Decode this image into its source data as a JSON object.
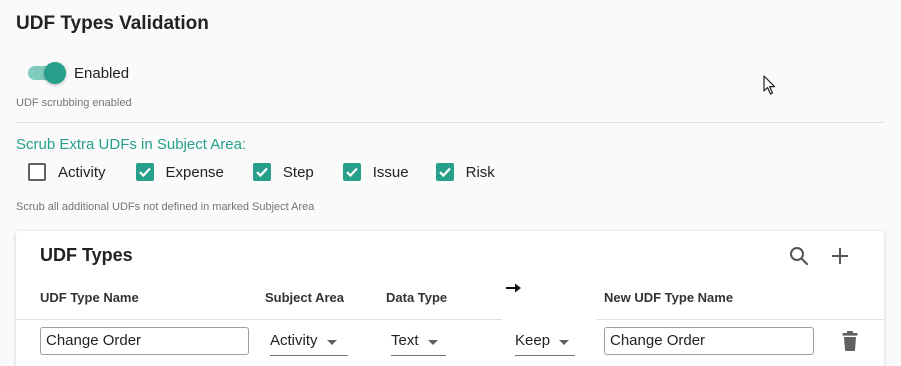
{
  "page": {
    "title": "UDF Types Validation"
  },
  "toggle": {
    "label": "Enabled",
    "state": "on",
    "hint": "UDF scrubbing enabled"
  },
  "scrub": {
    "heading": "Scrub Extra UDFs in Subject Area:",
    "hint": "Scrub all additional UDFs not defined in marked Subject Area",
    "options": [
      {
        "label": "Activity",
        "checked": false
      },
      {
        "label": "Expense",
        "checked": true
      },
      {
        "label": "Step",
        "checked": true
      },
      {
        "label": "Issue",
        "checked": true
      },
      {
        "label": "Risk",
        "checked": true
      }
    ]
  },
  "udf_types": {
    "title": "UDF Types",
    "icons": [
      "search-icon",
      "add-icon"
    ],
    "columns": {
      "name": "UDF Type Name",
      "subject_area": "Subject Area",
      "data_type": "Data Type",
      "arrow": "→",
      "new_name": "New UDF Type Name"
    },
    "rows": [
      {
        "name": "Change Order",
        "subject_area": "Activity",
        "data_type": "Text",
        "action": "Keep",
        "new_name": "Change Order"
      }
    ]
  },
  "colors": {
    "accent": "#26a08a",
    "accent_light": "#7fccbf"
  }
}
